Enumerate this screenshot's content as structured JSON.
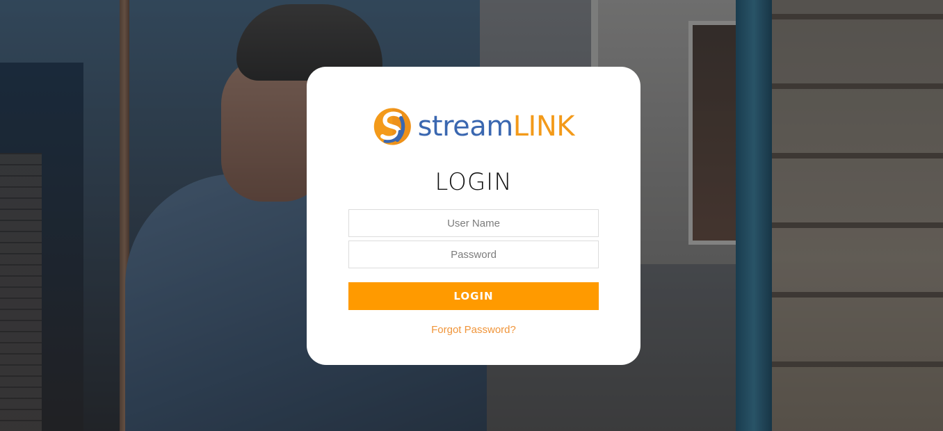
{
  "logo": {
    "name_part1": "stream",
    "name_part2": "LINK",
    "icon": "streamlink-s-logo-icon",
    "colors": {
      "blue": "#3a67b0",
      "orange": "#f39a1a"
    }
  },
  "login_form": {
    "title": "LOGIN",
    "username_placeholder": "User Name",
    "username_value": "",
    "password_placeholder": "Password",
    "password_value": "",
    "submit_label": "LOGIN",
    "forgot_link": "Forgot Password?"
  },
  "theme": {
    "accent": "#ff9a00",
    "link": "#f0953a",
    "card_bg": "#ffffff"
  }
}
